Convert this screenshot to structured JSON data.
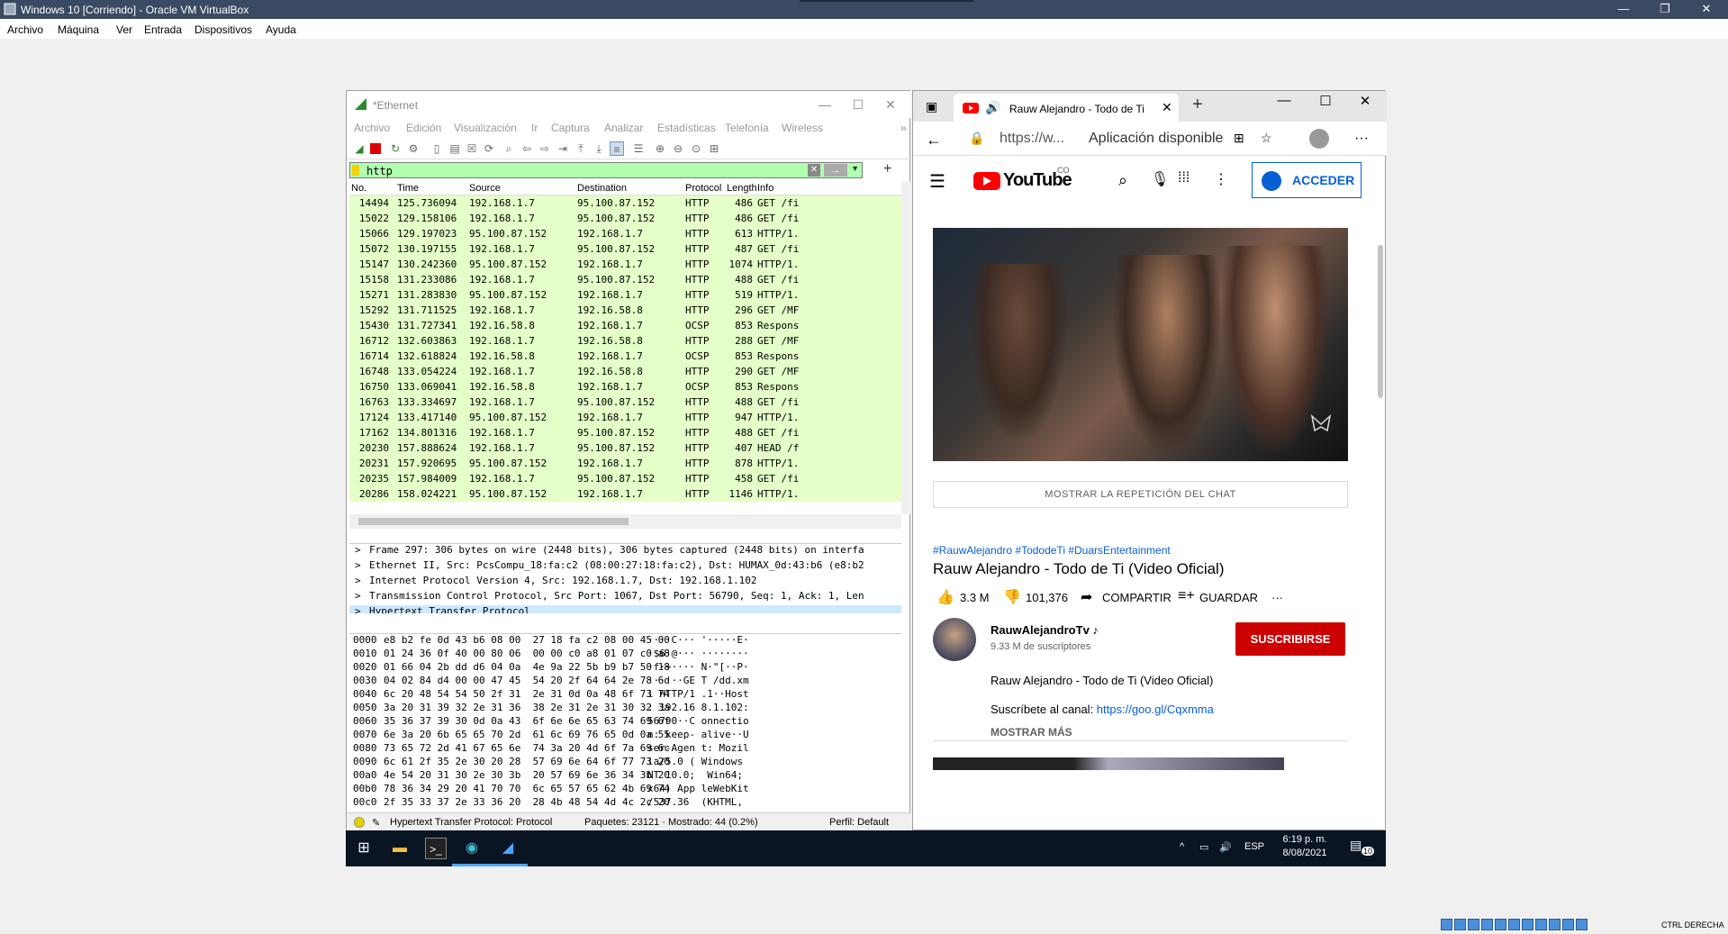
{
  "window": {
    "title": "Windows 10 [Corriendo] - Oracle VM VirtualBox",
    "controls": [
      "—",
      "❐",
      "✕"
    ]
  },
  "menu": [
    "Archivo",
    "Máquina",
    "Ver",
    "Entrada",
    "Dispositivos",
    "Ayuda"
  ],
  "wireshark": {
    "title": "*Ethernet",
    "menu": [
      "Archivo",
      "Edición",
      "Visualización",
      "Ir",
      "Captura",
      "Analizar",
      "Estadísticas",
      "Telefonía",
      "Wireless"
    ],
    "filter": "http",
    "columns": [
      "No.",
      "Time",
      "Source",
      "Destination",
      "Protocol",
      "Length",
      "Info"
    ],
    "packets": [
      [
        "14494",
        "125.736094",
        "192.168.1.7",
        "95.100.87.152",
        "HTTP",
        "486",
        "GET /fi"
      ],
      [
        "15022",
        "129.158106",
        "192.168.1.7",
        "95.100.87.152",
        "HTTP",
        "486",
        "GET /fi"
      ],
      [
        "15066",
        "129.197023",
        "95.100.87.152",
        "192.168.1.7",
        "HTTP",
        "613",
        "HTTP/1."
      ],
      [
        "15072",
        "130.197155",
        "192.168.1.7",
        "95.100.87.152",
        "HTTP",
        "487",
        "GET /fi"
      ],
      [
        "15147",
        "130.242360",
        "95.100.87.152",
        "192.168.1.7",
        "HTTP",
        "1074",
        "HTTP/1."
      ],
      [
        "15158",
        "131.233086",
        "192.168.1.7",
        "95.100.87.152",
        "HTTP",
        "488",
        "GET /fi"
      ],
      [
        "15271",
        "131.283830",
        "95.100.87.152",
        "192.168.1.7",
        "HTTP",
        "519",
        "HTTP/1."
      ],
      [
        "15292",
        "131.711525",
        "192.168.1.7",
        "192.16.58.8",
        "HTTP",
        "296",
        "GET /MF"
      ],
      [
        "15430",
        "131.727341",
        "192.16.58.8",
        "192.168.1.7",
        "OCSP",
        "853",
        "Respons"
      ],
      [
        "16712",
        "132.603863",
        "192.168.1.7",
        "192.16.58.8",
        "HTTP",
        "288",
        "GET /MF"
      ],
      [
        "16714",
        "132.618824",
        "192.16.58.8",
        "192.168.1.7",
        "OCSP",
        "853",
        "Respons"
      ],
      [
        "16748",
        "133.054224",
        "192.168.1.7",
        "192.16.58.8",
        "HTTP",
        "290",
        "GET /MF"
      ],
      [
        "16750",
        "133.069041",
        "192.16.58.8",
        "192.168.1.7",
        "OCSP",
        "853",
        "Respons"
      ],
      [
        "16763",
        "133.334697",
        "192.168.1.7",
        "95.100.87.152",
        "HTTP",
        "488",
        "GET /fi"
      ],
      [
        "17124",
        "133.417140",
        "95.100.87.152",
        "192.168.1.7",
        "HTTP",
        "947",
        "HTTP/1."
      ],
      [
        "17162",
        "134.801316",
        "192.168.1.7",
        "95.100.87.152",
        "HTTP",
        "488",
        "GET /fi"
      ],
      [
        "20230",
        "157.888624",
        "192.168.1.7",
        "95.100.87.152",
        "HTTP",
        "407",
        "HEAD /f"
      ],
      [
        "20231",
        "157.920695",
        "95.100.87.152",
        "192.168.1.7",
        "HTTP",
        "878",
        "HTTP/1."
      ],
      [
        "20235",
        "157.984009",
        "192.168.1.7",
        "95.100.87.152",
        "HTTP",
        "458",
        "GET /fi"
      ],
      [
        "20286",
        "158.024221",
        "95.100.87.152",
        "192.168.1.7",
        "HTTP",
        "1146",
        "HTTP/1."
      ]
    ],
    "details": [
      "Frame 297: 306 bytes on wire (2448 bits), 306 bytes captured (2448 bits) on interfa",
      "Ethernet II, Src: PcsCompu_18:fa:c2 (08:00:27:18:fa:c2), Dst: HUMAX_0d:43:b6 (e8:b2",
      "Internet Protocol Version 4, Src: 192.168.1.7, Dst: 192.168.1.102",
      "Transmission Control Protocol, Src Port: 1067, Dst Port: 56790, Seq: 1, Ack: 1, Len",
      "Hypertext Transfer Protocol"
    ],
    "hex": [
      [
        "0000",
        "e8 b2 fe 0d 43 b6 08 00  27 18 fa c2 08 00 45 00",
        "····C··· '·····E·"
      ],
      [
        "0010",
        "01 24 36 0f 40 00 80 06  00 00 c0 a8 01 07 c0 a8",
        "·$6·@··· ········"
      ],
      [
        "0020",
        "01 66 04 2b dd d6 04 0a  4e 9a 22 5b b9 b7 50 18",
        "·f·+···· N·\"[··P·"
      ],
      [
        "0030",
        "04 02 84 d4 00 00 47 45  54 20 2f 64 64 2e 78 6d",
        "······GE T /dd.xm"
      ],
      [
        "0040",
        "6c 20 48 54 54 50 2f 31  2e 31 0d 0a 48 6f 73 74",
        "l HTTP/1 .1··Host"
      ],
      [
        "0050",
        "3a 20 31 39 32 2e 31 36  38 2e 31 2e 31 30 32 3a",
        ": 192.16 8.1.102:"
      ],
      [
        "0060",
        "35 36 37 39 30 0d 0a 43  6f 6e 6e 65 63 74 69 6f",
        "56790··C onnectio"
      ],
      [
        "0070",
        "6e 3a 20 6b 65 65 70 2d  61 6c 69 76 65 0d 0a 55",
        "n: keep- alive··U"
      ],
      [
        "0080",
        "73 65 72 2d 41 67 65 6e  74 3a 20 4d 6f 7a 69 6c",
        "ser-Agen t: Mozil"
      ],
      [
        "0090",
        "6c 61 2f 35 2e 30 20 28  57 69 6e 64 6f 77 73 20",
        "la/5.0 ( Windows "
      ],
      [
        "00a0",
        "4e 54 20 31 30 2e 30 3b  20 57 69 6e 36 34 3b 20",
        "NT 10.0;  Win64; "
      ],
      [
        "00b0",
        "78 36 34 29 20 41 70 70  6c 65 57 65 62 4b 69 74",
        "x64) App leWebKit"
      ],
      [
        "00c0",
        "2f 35 33 37 2e 33 36 20  28 4b 48 54 4d 4c 2c 20",
        "/537.36  (KHTML, "
      ]
    ],
    "status_left": "Hypertext Transfer Protocol: Protocol",
    "status_packets": "Paquetes: 23121 · Mostrado: 44 (0.2%)",
    "status_profile": "Perfil: Default"
  },
  "edge": {
    "tab_title": "Rauw Alejandro - Todo de Ti",
    "url": "https://w...",
    "app_available": "Aplicación disponible",
    "yt_name": "YouTube",
    "yt_country": "CO",
    "sign_in": "ACCEDER",
    "show_chat": "MOSTRAR LA REPETICIÓN DEL CHAT",
    "tags": "#RauwAlejandro #TododeTi #DuarsEntertainment",
    "video_title": "Rauw Alejandro - Todo de Ti (Video Oficial)",
    "likes": "3.3 M",
    "dislikes": "101,376",
    "share": "COMPARTIR",
    "save": "GUARDAR",
    "more": "···",
    "channel": "RauwAlejandroTv ♪",
    "subscribers": "9.33 M de suscriptores",
    "subscribe": "SUSCRIBIRSE",
    "description": "Rauw Alejandro - Todo de Ti (Video Oficial)",
    "subscribe_text": "Suscríbete al canal: ",
    "subscribe_link": "https://goo.gl/Cqxmma",
    "show_more": "MOSTRAR MÁS"
  },
  "taskbar": {
    "lang": "ESP",
    "time": "6:19 p. m.",
    "date": "8/08/2021",
    "notif": "10"
  },
  "vb_status": "CTRL DERECHA"
}
